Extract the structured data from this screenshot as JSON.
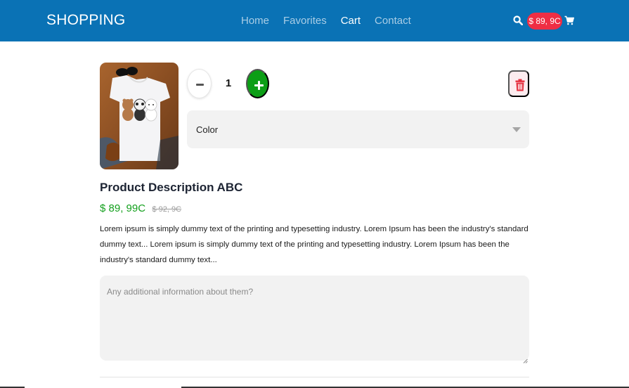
{
  "header": {
    "brand": "SHOPPING",
    "nav": [
      {
        "label": "Home",
        "active": false
      },
      {
        "label": "Favorites",
        "active": false
      },
      {
        "label": "Cart",
        "active": true
      },
      {
        "label": "Contact",
        "active": false
      }
    ],
    "cart_total": "$ 89, 9C",
    "icons": {
      "search": "search-icon",
      "cart": "shopping-cart-icon"
    },
    "colors": {
      "bar": "#0a72b5",
      "badge": "#ef2e44"
    }
  },
  "cart_item": {
    "image_alt": "White t-shirt with three bears print",
    "quantity": "1",
    "icons": {
      "decrease": "minus-icon",
      "increase": "plus-icon",
      "delete": "trash-icon",
      "select": "caret-down-icon"
    },
    "color_select": {
      "label": "Color"
    },
    "title": "Product Description ABC",
    "price": "$ 89, 99C",
    "old_price": "$ 92, 9C",
    "description": "Lorem ipsum is simply dummy text of the printing and typesetting industry. Lorem Ipsum has been the industry's standard dummy text... Lorem ipsum is simply dummy text of the printing and typesetting industry. Lorem Ipsum has been the industry's standard dummy text...",
    "notes": {
      "placeholder": "Any additional information about them?",
      "value": ""
    },
    "colors": {
      "price": "#14a01e",
      "plus_button": "#0c9e16",
      "delete": "#e5303f"
    }
  }
}
